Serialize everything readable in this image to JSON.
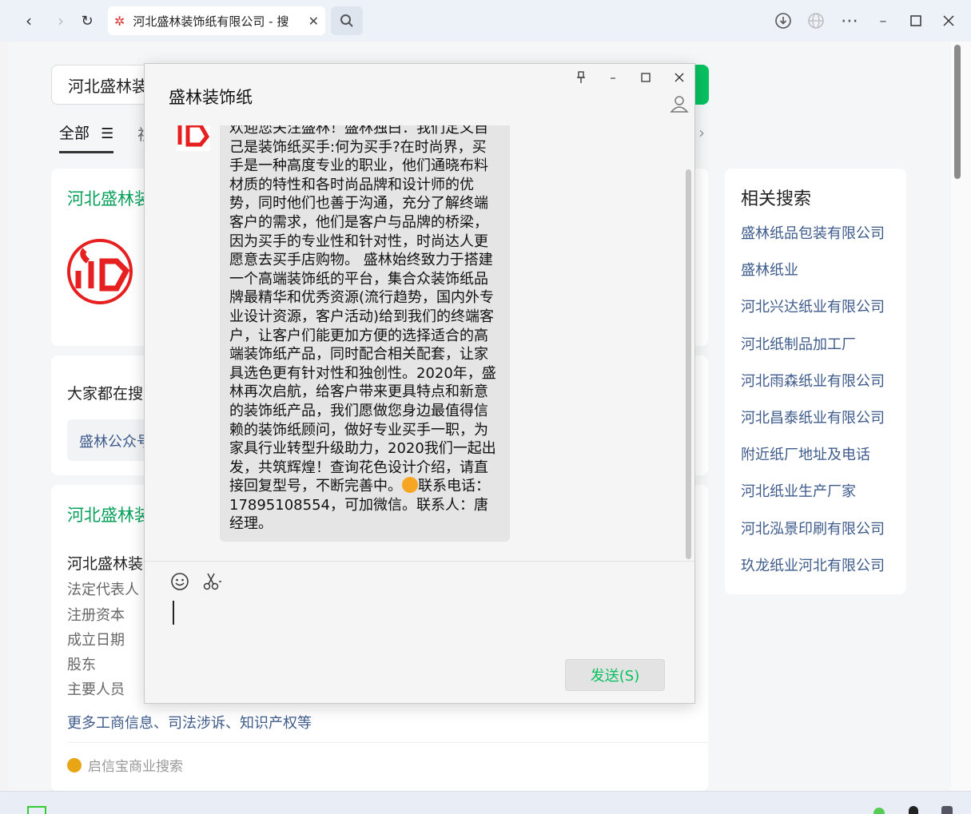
{
  "browser": {
    "tab_title": "河北盛林装饰纸有限公司 - 搜",
    "tab_close": "✕"
  },
  "search": {
    "query": "河北盛林装"
  },
  "filters": {
    "all": "全部",
    "next": "视"
  },
  "result1": {
    "title": "河北盛林装"
  },
  "people_search": {
    "heading": "大家都在搜",
    "chip": "盛林公众号"
  },
  "company": {
    "title": "河北盛林装",
    "name": "河北盛林装",
    "labels": [
      "法定代表人",
      "注册资本",
      "成立日期",
      "股东",
      "主要人员"
    ],
    "more_link": "更多工商信息、司法涉诉、知识产权等",
    "source": "启信宝商业搜索"
  },
  "related": {
    "heading": "相关搜索",
    "items": [
      "盛林纸品包装有限公司",
      "盛林纸业",
      "河北兴达纸业有限公司",
      "河北纸制品加工厂",
      "河北雨森纸业有限公司",
      "河北昌泰纸业有限公司",
      "附近纸厂地址及电话",
      "河北纸业生产厂家",
      "河北泓景印刷有限公司",
      "玖龙纸业河北有限公司"
    ]
  },
  "chat": {
    "title": "盛林装饰纸",
    "message_part1": "欢迎您关注盛林！盛林独白：我们定义自己是装饰纸买手:何为买手?在时尚界，买手是一种高度专业的职业，他们通晓布料材质的特性和各时尚品牌和设计师的优势，同时他们也善于沟通，充分了解终端客户的需求，他们是客户与品牌的桥梁，因为买手的专业性和针对性，时尚达人更愿意去买手店购物。 盛林始终致力于搭建一个高端装饰纸的平台，集合众装饰纸品牌最精华和优秀资源(流行趋势，国内外专业设计资源，客户活动)给到我们的终端客户，让客户们能更加方便的选择适合的高端装饰纸产品，同时配合相关配套，让家具选色更有针对性和独创性。2020年，盛林再次启航，给客户带来更具特点和新意的装饰纸产品，我们愿做您身边最值得信赖的装饰纸顾问，做好专业买手一职，为家具行业转型升级助力，2020我们一起出发，共筑辉煌！查询花色设计介绍，请直接回复型号，不断完善中。",
    "message_part2": "联系电话：",
    "message_part3": "17895108554，可加微信。联系人：唐经理。",
    "send_label": "发送(S)"
  },
  "colors": {
    "accent_green": "#07c160",
    "link_blue": "#3e5b8c"
  }
}
